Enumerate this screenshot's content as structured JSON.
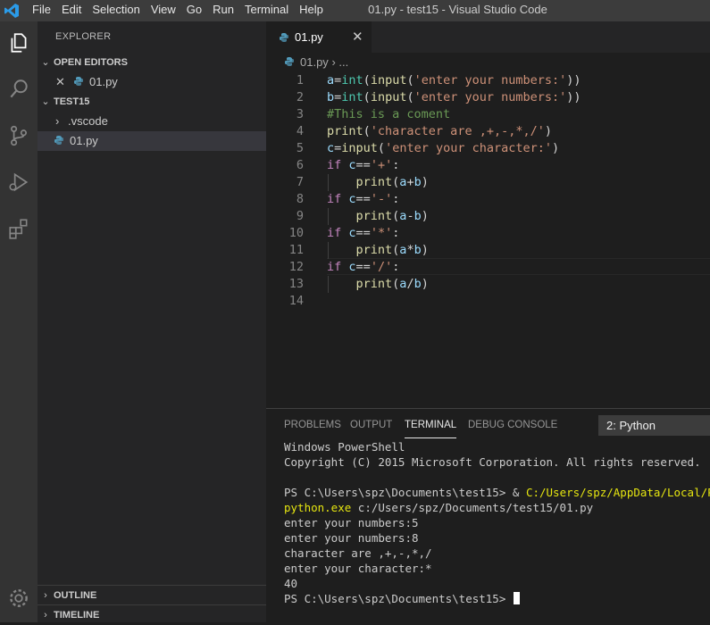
{
  "window": {
    "title": "01.py - test15 - Visual Studio Code",
    "menu": [
      "File",
      "Edit",
      "Selection",
      "View",
      "Go",
      "Run",
      "Terminal",
      "Help"
    ]
  },
  "activity_bar": {
    "items": [
      "explorer-icon",
      "search-icon",
      "source-control-icon",
      "run-debug-icon",
      "extensions-icon"
    ],
    "bottom": "gear-icon"
  },
  "sidebar": {
    "title": "EXPLORER",
    "open_editors": {
      "label": "OPEN EDITORS",
      "items": [
        {
          "name": "01.py"
        }
      ]
    },
    "workspace": {
      "label": "TEST15",
      "items": [
        {
          "name": ".vscode"
        },
        {
          "name": "01.py"
        }
      ]
    },
    "outline_label": "OUTLINE",
    "timeline_label": "TIMELINE"
  },
  "editor": {
    "tab_label": "01.py",
    "breadcrumb": {
      "file": "01.py",
      "sep": "›",
      "rest": "..."
    },
    "line_numbers": [
      "1",
      "2",
      "3",
      "4",
      "5",
      "6",
      "7",
      "8",
      "9",
      "10",
      "11",
      "12",
      "13",
      "14"
    ],
    "lines": [
      "a=int(input('enter your numbers:'))",
      "b=int(input('enter your numbers:'))",
      "#This is a coment",
      "print('character are ,+,-,*,/')",
      "c=input('enter your character:')",
      "if c=='+':",
      "    print(a+b)",
      "if c=='-':",
      "    print(a-b)",
      "if c=='*':",
      "    print(a*b)",
      "if c=='/':",
      "    print(a/b)",
      ""
    ]
  },
  "panel": {
    "tabs": [
      "PROBLEMS",
      "OUTPUT",
      "TERMINAL",
      "DEBUG CONSOLE"
    ],
    "active_tab": "TERMINAL",
    "terminal_select": "2: Python",
    "terminal": {
      "l1": "Windows PowerShell",
      "l2": "Copyright (C) 2015 Microsoft Corporation. All rights reserved.",
      "l3": "",
      "prompt1": "PS C:\\Users\\spz\\Documents\\test15> & ",
      "cmd_path": "C:/Users/spz/AppData/Local/Progr",
      "cmd_exe": "python.exe",
      "cmd_arg": " c:/Users/spz/Documents/test15/01.py",
      "o1": "enter your numbers:5",
      "o2": "enter your numbers:8",
      "o3": "character are ,+,-,*,/",
      "o4": "enter your character:*",
      "o5": "40",
      "prompt2": "PS C:\\Users\\spz\\Documents\\test15> "
    }
  },
  "colors": {
    "accent": "#007acc",
    "python_icon": "#519aba",
    "terminal_yellow": "#e5e510"
  }
}
